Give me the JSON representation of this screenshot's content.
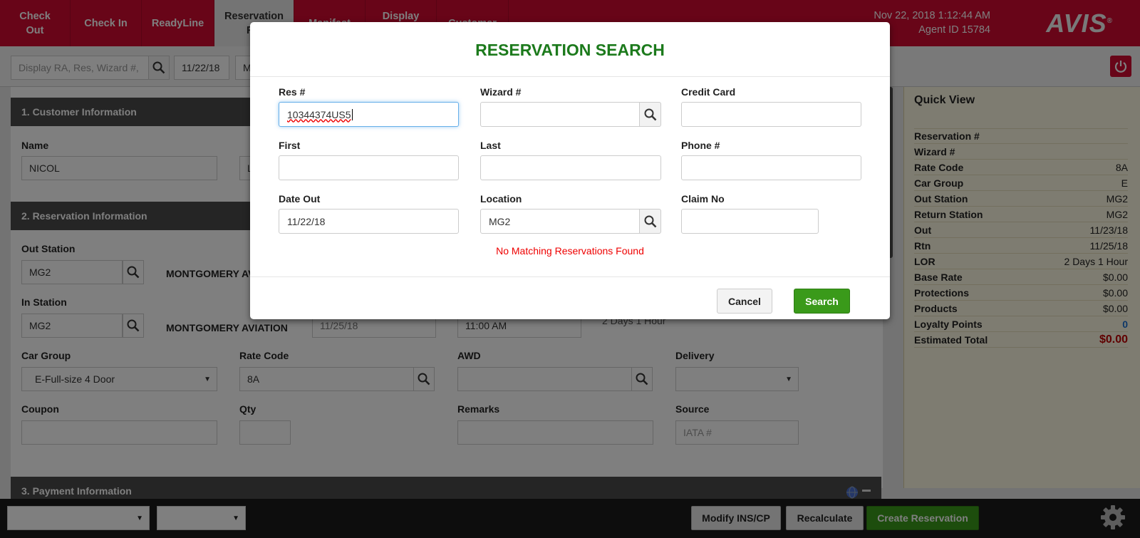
{
  "topbar": {
    "tabs": [
      {
        "label": "Check\nOut"
      },
      {
        "label": "Check In"
      },
      {
        "label": "ReadyLine"
      },
      {
        "label": "Reservation\nRA"
      },
      {
        "label": "Manifest"
      },
      {
        "label": "Display\nRA"
      },
      {
        "label": "Customer"
      }
    ],
    "datetime": "Nov 22, 2018 1:12:44 AM",
    "agent": "Agent ID 15784",
    "logo": "AVIS"
  },
  "subbar": {
    "display_placeholder": "Display RA, Res, Wizard #,",
    "date": "11/22/18",
    "extra": "M"
  },
  "main": {
    "sec1": "1. Customer Information",
    "name_label": "Name",
    "name_value": "NICOL",
    "last_value": "L",
    "sec2": "2. Reservation Information",
    "out_station_label": "Out Station",
    "out_station_value": "MG2",
    "out_station_name": "MONTGOMERY AVIATION",
    "in_station_label": "In Station",
    "in_station_value": "MG2",
    "in_station_name": "MONTGOMERY AVIATION",
    "in_date": "11/25/18",
    "in_time": "11:00 AM",
    "lor_partial": "2 Days 1 Hour",
    "car_group_label": "Car Group",
    "car_group_value": "E-Full-size 4 Door",
    "rate_code_label": "Rate Code",
    "rate_code_value": "8A",
    "awd_label": "AWD",
    "delivery_label": "Delivery",
    "coupon_label": "Coupon",
    "qty_label": "Qty",
    "remarks_label": "Remarks",
    "source_label": "Source",
    "source_placeholder": "IATA #",
    "sec3": "3. Payment Information"
  },
  "quickview": {
    "title": "Quick View",
    "rows": [
      {
        "k": "Reservation #",
        "v": ""
      },
      {
        "k": "Wizard #",
        "v": ""
      },
      {
        "k": "Rate Code",
        "v": "8A"
      },
      {
        "k": "Car Group",
        "v": "E"
      },
      {
        "k": "Out Station",
        "v": "MG2"
      },
      {
        "k": "Return Station",
        "v": "MG2"
      },
      {
        "k": "Out",
        "v": "11/23/18"
      },
      {
        "k": "Rtn",
        "v": "11/25/18"
      },
      {
        "k": "LOR",
        "v": "2 Days 1 Hour"
      },
      {
        "k": "Base Rate",
        "v": "$0.00"
      },
      {
        "k": "Protections",
        "v": "$0.00"
      },
      {
        "k": "Products",
        "v": "$0.00"
      },
      {
        "k": "Loyalty Points",
        "v": "0"
      },
      {
        "k": "Estimated Total",
        "v": "$0.00"
      }
    ]
  },
  "bottombar": {
    "modify": "Modify INS/CP",
    "recalculate": "Recalculate",
    "create": "Create Reservation"
  },
  "modal": {
    "title": "RESERVATION SEARCH",
    "res_label": "Res #",
    "res_value": "10344374US5",
    "wizard_label": "Wizard #",
    "cc_label": "Credit Card",
    "first_label": "First",
    "last_label": "Last",
    "phone_label": "Phone #",
    "dateout_label": "Date Out",
    "dateout_value": "11/22/18",
    "location_label": "Location",
    "location_value": "MG2",
    "claim_label": "Claim No",
    "no_match": "No Matching Reservations Found",
    "cancel": "Cancel",
    "search": "Search"
  },
  "colors": {
    "brand_red": "#d10a31",
    "green": "#3a9a1a",
    "title_green": "#1c7a1c",
    "error_red": "#e00000",
    "total_red": "#c00000",
    "loyalty_blue": "#1a6fd1"
  },
  "icons": [
    "search-icon",
    "power-icon",
    "gear-icon",
    "globe-icon",
    "minus-icon",
    "chevron-down-icon"
  ]
}
